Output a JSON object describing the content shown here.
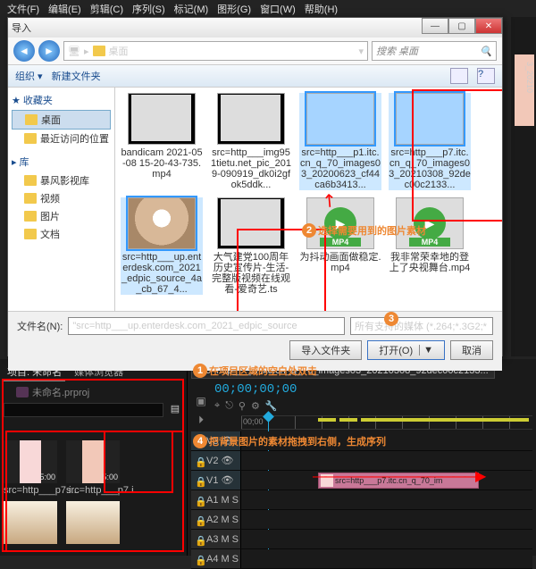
{
  "menubar": [
    "文件(F)",
    "编辑(E)",
    "剪辑(C)",
    "序列(S)",
    "标记(M)",
    "图形(G)",
    "窗口(W)",
    "帮助(H)"
  ],
  "dialog": {
    "title": "导入",
    "path_label": "桌面",
    "search_placeholder": "搜索 桌面",
    "organize": "组织 ▾",
    "newfolder": "新建文件夹",
    "sidebar": {
      "fav": "收藏夹",
      "fav_items": [
        "桌面",
        "最近访问的位置"
      ],
      "lib": "库",
      "lib_items": [
        "暴风影视库",
        "视频",
        "图片",
        "文档"
      ]
    },
    "files": [
      {
        "name": "bandicam 2021-05-08 15-20-43-735.mp4",
        "kind": "video"
      },
      {
        "name": "src=http___img951tietu.net_pic_2019-090919_dk0i2gfok5ddk...",
        "kind": "video"
      },
      {
        "name": "src=http___p1.itc.cn_q_70_images03_20200623_cf44ca6b3413...",
        "kind": "pink1",
        "sel": true
      },
      {
        "name": "src=http___p7.itc.cn_q_70_images03_20210308_92dec00c2133...",
        "kind": "pink2",
        "sel": true
      },
      {
        "name": "src=http___up.enterdesk.com_2021_edpic_source_4a_cb_67_4...",
        "kind": "dog",
        "sel": true
      },
      {
        "name": "大气建党100周年历史宣传片-生活-完整版视频在线观看-爱奇艺.ts",
        "kind": "video"
      },
      {
        "name": "为抖动画面做稳定.mp4",
        "kind": "mp4"
      },
      {
        "name": "我非常荣幸地的登上了央视舞台.mp4",
        "kind": "mp4"
      }
    ],
    "filename_label": "文件名(N):",
    "filename_value": "\"src=http___up.enterdesk.com_2021_edpic_source",
    "filter": "所有支持的媒体 (*.264;*.3G2;*",
    "import_folder": "导入文件夹",
    "open": "打开(O)",
    "cancel": "取消"
  },
  "annots": {
    "a1": "在项目区域的空白处双击",
    "a2": "选择需要用到的图片素材",
    "a3": "",
    "a4": "把背景图片的素材拖拽到右侧，生成序列"
  },
  "project": {
    "tab1": "项目: 未命名",
    "tab2": "媒体浏览器",
    "name": "未命名.prproj",
    "bins": [
      {
        "name": "src=http___p7.i...",
        "dur": "5:00",
        "cls": "p1"
      },
      {
        "name": "src=http___p7.i...",
        "dur": "5:00",
        "cls": "p2"
      },
      {
        "name": "",
        "dur": "",
        "cls": "dog"
      },
      {
        "name": "",
        "dur": "",
        "cls": "dog"
      }
    ]
  },
  "timeline": {
    "seq": "src=http___p7.itc.cn_q_70_images03_20210308_92dec00c2133...",
    "timecode": "00;00;00;00",
    "ruler0": "00;00",
    "tracks_v": [
      "V3",
      "V2",
      "V1"
    ],
    "tracks_a": [
      "A1",
      "A2",
      "A3",
      "A4"
    ],
    "clip": "src=http___p7.itc.cn_q_70_im"
  },
  "rstrip": "3_20210"
}
